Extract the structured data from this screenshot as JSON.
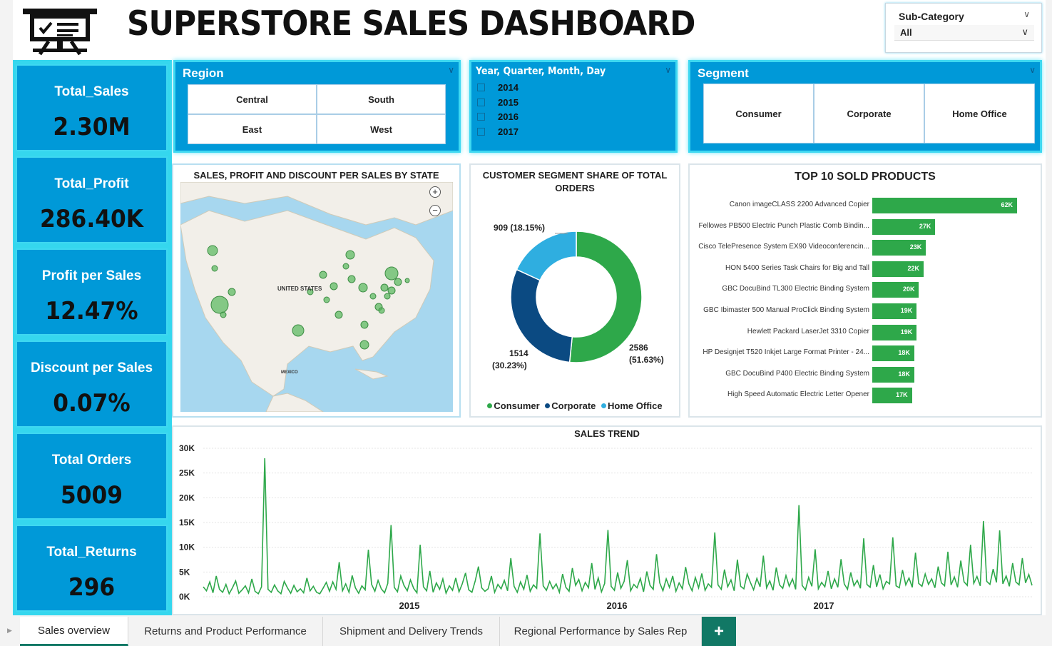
{
  "dashboard": {
    "title": "SUPERSTORE SALES DASHBOARD"
  },
  "filters": {
    "subcategory": {
      "label": "Sub-Category",
      "value": "All"
    },
    "region": {
      "title": "Region",
      "options": [
        "Central",
        "South",
        "East",
        "West"
      ]
    },
    "date": {
      "title": "Year, Quarter, Month, Day",
      "years": [
        "2014",
        "2015",
        "2016",
        "2017"
      ]
    },
    "segment": {
      "title": "Segment",
      "options": [
        "Consumer",
        "Corporate",
        "Home Office"
      ]
    }
  },
  "kpis": [
    {
      "label": "Total_Sales",
      "value": "2.30M"
    },
    {
      "label": "Total_Profit",
      "value": "286.40K"
    },
    {
      "label": "Profit per Sales",
      "value": "12.47%"
    },
    {
      "label": "Discount per Sales",
      "value": "0.07%"
    },
    {
      "label": "Total Orders",
      "value": "5009"
    },
    {
      "label": "Total_Returns",
      "value": "296"
    }
  ],
  "map_panel": {
    "title": "SALES, PROFIT AND DISCOUNT PER SALES BY STATE",
    "labels": {
      "usa": "UNITED STATES",
      "mexico": "MEXICO"
    },
    "zoom_in": "+",
    "zoom_out": "−"
  },
  "colors": {
    "consumer": "#2ea84a",
    "corporate": "#0b4a82",
    "home_office": "#2faee0",
    "kpi_bg": "#0099d8",
    "accent": "#3ed8f1",
    "tab_accent": "#117865",
    "trend_line": "#2ea84a"
  },
  "donut_panel": {
    "title_line1": "CUSTOMER SEGMENT SHARE OF TOTAL",
    "title_line2": "ORDERS",
    "labels": {
      "consumer_count": "2586",
      "consumer_pct": "(51.63%)",
      "corporate_count": "1514",
      "corporate_pct": "(30.23%)",
      "home_office": "909 (18.15%)"
    },
    "legend": [
      "Consumer",
      "Corporate",
      "Home Office"
    ]
  },
  "products_panel": {
    "title": "TOP 10 SOLD PRODUCTS"
  },
  "trend_panel": {
    "title": "SALES TREND"
  },
  "chart_data": [
    {
      "type": "pie",
      "title": "CUSTOMER SEGMENT SHARE OF TOTAL ORDERS",
      "categories": [
        "Consumer",
        "Corporate",
        "Home Office"
      ],
      "values": [
        2586,
        1514,
        909
      ],
      "percentages": [
        51.63,
        30.23,
        18.15
      ]
    },
    {
      "type": "bar",
      "orientation": "horizontal",
      "title": "TOP 10 SOLD PRODUCTS",
      "categories": [
        "Canon imageCLASS 2200 Advanced Copier",
        "Fellowes PB500 Electric Punch Plastic Comb Bindin...",
        "Cisco TelePresence System EX90 Videoconferencin...",
        "HON 5400 Series Task Chairs for Big and Tall",
        "GBC DocuBind TL300 Electric Binding System",
        "GBC Ibimaster 500 Manual ProClick Binding System",
        "Hewlett Packard LaserJet 3310 Copier",
        "HP Designjet T520 Inkjet Large Format Printer - 24...",
        "GBC DocuBind P400 Electric Binding System",
        "High Speed Automatic Electric Letter Opener"
      ],
      "values": [
        62000,
        27000,
        23000,
        22000,
        20000,
        19000,
        19000,
        18000,
        18000,
        17000
      ],
      "value_labels": [
        "62K",
        "27K",
        "23K",
        "22K",
        "20K",
        "19K",
        "19K",
        "18K",
        "18K",
        "17K"
      ]
    },
    {
      "type": "line",
      "title": "SALES TREND",
      "ylim": [
        0,
        30000
      ],
      "yticks": [
        "30K",
        "25K",
        "20K",
        "15K",
        "10K",
        "5K",
        "0K"
      ],
      "xticks": [
        "2015",
        "2016",
        "2017"
      ],
      "series": [
        {
          "values": [
            2000,
            1200,
            3000,
            800,
            4200,
            1500,
            900,
            2500,
            600,
            1800,
            3200,
            700,
            1400,
            2200,
            800,
            3600,
            1100,
            600,
            2000,
            28000,
            1500,
            900,
            2400,
            1200,
            600,
            3100,
            1800,
            700,
            2300,
            1000,
            1600,
            800,
            3800,
            1200,
            2100,
            900,
            600,
            1700,
            2900,
            1100,
            3000,
            1500,
            7000,
            1200,
            2600,
            900,
            4300,
            1800,
            700,
            2200,
            1400,
            9500,
            2500,
            1100,
            3300,
            1600,
            800,
            2700,
            14500,
            1900,
            1000,
            4200,
            2300,
            1200,
            3400,
            1700,
            800,
            10500,
            2000,
            1200,
            5200,
            900,
            2800,
            1500,
            3600,
            700,
            2200,
            1300,
            3800,
            1000,
            2600,
            4800,
            1400,
            900,
            3200,
            6100,
            1800,
            1100,
            1600,
            4200,
            900,
            2500,
            1600,
            3300,
            1200,
            7800,
            2100,
            900,
            3000,
            1500,
            4400,
            1100,
            2400,
            1700,
            12800,
            2200,
            1300,
            3100,
            1600,
            2600,
            900,
            4600,
            1900,
            1100,
            5800,
            2300,
            3500,
            1200,
            2900,
            1800,
            6800,
            1500,
            3800,
            1000,
            2700,
            13500,
            2100,
            1300,
            4900,
            1700,
            3100,
            7400,
            1200,
            2500,
            1800,
            3700,
            1000,
            5100,
            2300,
            1500,
            8600,
            2800,
            1200,
            3600,
            1900,
            4200,
            1100,
            2800,
            1600,
            6000,
            2600,
            1200,
            3900,
            1800,
            4700,
            1300,
            2600,
            1900,
            13000,
            2400,
            1500,
            5500,
            2000,
            3400,
            1200,
            7500,
            2100,
            1600,
            4600,
            2900,
            1400,
            3700,
            2000,
            8300,
            1800,
            3200,
            1300,
            5900,
            2400,
            1700,
            4300,
            2100,
            3600,
            1500,
            18500,
            2300,
            1400,
            3900,
            2100,
            9600,
            1600,
            2900,
            2000,
            5200,
            1600,
            3600,
            1900,
            7600,
            2600,
            1500,
            4900,
            2200,
            3300,
            1700,
            11800,
            2500,
            1900,
            6400,
            2000,
            4500,
            1600,
            3100,
            2600,
            12000,
            2200,
            1800,
            5400,
            2400,
            3800,
            1900,
            8900,
            2700,
            2100,
            4600,
            2500,
            3600,
            1800,
            6100,
            2800,
            2200,
            9100,
            2400,
            4000,
            1900,
            7300,
            3000,
            2300,
            10500,
            2700,
            4100,
            2200,
            15300,
            3100,
            2500,
            5600,
            2900,
            13400,
            2600,
            4200,
            2100,
            6800,
            3000,
            2400,
            7800,
            2800,
            4500,
            2300
          ]
        }
      ]
    }
  ],
  "tabs": [
    {
      "label": "Sales overview"
    },
    {
      "label": "Returns and Product Performance"
    },
    {
      "label": "Shipment and Delivery Trends"
    },
    {
      "label": "Regional Performance by Sales Rep"
    }
  ],
  "tab_add_label": "+"
}
